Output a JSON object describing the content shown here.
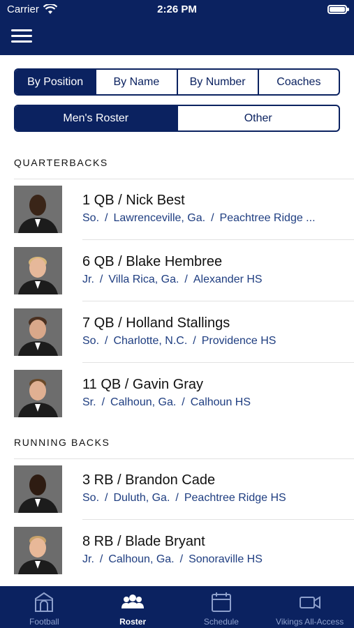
{
  "status_bar": {
    "carrier": "Carrier",
    "time": "2:26 PM"
  },
  "view_toggle": {
    "options": [
      "By Position",
      "By Name",
      "By Number",
      "Coaches"
    ],
    "selected": "By Position"
  },
  "roster_toggle": {
    "options": [
      "Men's Roster",
      "Other"
    ],
    "selected": "Men's Roster"
  },
  "sections": [
    {
      "heading": "QUARTERBACKS",
      "players": [
        {
          "title": "1 QB / Nick Best",
          "year": "So.",
          "hometown": "Lawrenceville, Ga.",
          "school": "Peachtree Ridge ..."
        },
        {
          "title": "6 QB / Blake Hembree",
          "year": "Jr.",
          "hometown": "Villa Rica, Ga.",
          "school": "Alexander HS"
        },
        {
          "title": "7 QB / Holland Stallings",
          "year": "So.",
          "hometown": "Charlotte, N.C.",
          "school": "Providence HS"
        },
        {
          "title": "11 QB / Gavin Gray",
          "year": "Sr.",
          "hometown": "Calhoun, Ga.",
          "school": "Calhoun HS"
        }
      ]
    },
    {
      "heading": "RUNNING BACKS",
      "players": [
        {
          "title": "3 RB / Brandon Cade",
          "year": "So.",
          "hometown": "Duluth, Ga.",
          "school": "Peachtree Ridge HS"
        },
        {
          "title": "8 RB / Blade Bryant",
          "year": "Jr.",
          "hometown": "Calhoun, Ga.",
          "school": "Sonoraville HS"
        }
      ]
    }
  ],
  "separator": "/",
  "tab_bar": {
    "tabs": [
      {
        "label": "Football",
        "icon": "stadium-icon"
      },
      {
        "label": "Roster",
        "icon": "people-icon"
      },
      {
        "label": "Schedule",
        "icon": "calendar-icon"
      },
      {
        "label": "Vikings All-Access",
        "icon": "video-camera-icon"
      }
    ],
    "selected": "Roster"
  },
  "colors": {
    "navy": "#0b2260",
    "link_blue": "#1e3d80",
    "tab_inactive": "#8ea0cc"
  }
}
